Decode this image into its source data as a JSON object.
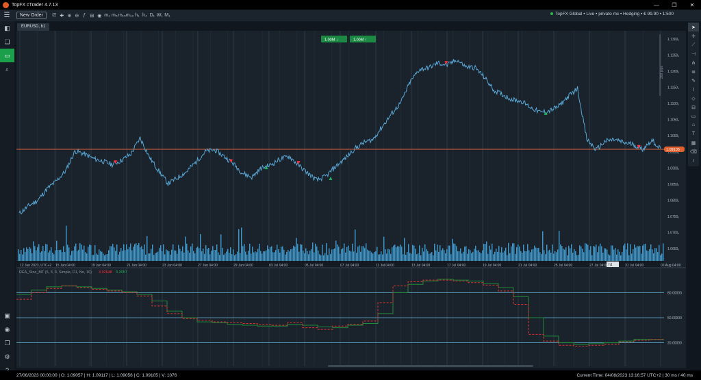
{
  "window": {
    "title": "TopFX cTrader 4.7.13"
  },
  "toolbar": {
    "new_order": "New Order",
    "icons": [
      "chart-type-icon",
      "crosshair-icon",
      "zoom-in-icon",
      "zoom-out-icon",
      "indicators-icon",
      "templates-icon",
      "visibility-icon",
      "tf-m1",
      "tf-m5",
      "tf-m15",
      "tf-m30",
      "tf-h1",
      "tf-h4",
      "tf-d1",
      "tf-w1",
      "tf-mn1"
    ],
    "labels": [
      "⎚",
      "✚",
      "⊕",
      "⊖",
      "ƒ",
      "⊞",
      "◉",
      "m₁",
      "m₅",
      "m₁₅",
      "m₃₀",
      "h₁",
      "h₄",
      "D₁",
      "W₁",
      "M₁"
    ]
  },
  "account": {
    "text": "TopFX Global • Live • privato mc • Hedging • € 99.90 • 1:500"
  },
  "tab": {
    "label": "EURUSD, h1"
  },
  "trade_buttons": {
    "sell": "1,00M ↓",
    "buy": "1,00M ↑"
  },
  "ruler": {
    "label": "200 pips"
  },
  "price_axis": {
    "labels": [
      "1.1300₀",
      "1.1250₀",
      "1.1200₀",
      "1.1150₀",
      "1.1100₀",
      "1.1050₀",
      "1.1000₀",
      "1.0950₀",
      "1.0900₀",
      "1.0850₀",
      "1.0800₀",
      "1.0750₀",
      "1.0700₀",
      "1.0650₀"
    ],
    "current": "1.09105"
  },
  "time_axis": {
    "labels": [
      "12 Jun 2023, UTC+2",
      "15 Jun 04:00",
      "19 Jun 04:00",
      "21 Jun 04:00",
      "23 Jun 04:00",
      "27 Jun 04:00",
      "29 Jun 04:00",
      "03 Jul 04:00",
      "05 Jul 04:00",
      "07 Jul 04:00",
      "11 Jul 04:00",
      "13 Jul 04:00",
      "17 Jul 04:00",
      "19 Jul 04:00",
      "21 Jul 04:00",
      "25 Jul 04:00",
      "27 Jul 04:00",
      "31 Jul 04:00",
      "02 Aug 04:00"
    ],
    "cursor_label": "h1"
  },
  "indicator": {
    "name": "REA_Stoc_MT (5, 3, 3, Simple, D1, No, 10)",
    "val1": "3.92648",
    "val2": "3.2057",
    "levels": [
      "80.00000",
      "50.00000",
      "20.00000"
    ]
  },
  "status": {
    "left": "27/06/2023 00:00:00 | O: 1.09057 | H: 1.09117 | L: 1.09056 | C: 1.09105 | V: 1076",
    "right": "Current Time: 04/08/2023 13:16:57   UTC+2   |  30 ms / 40 ms"
  },
  "colors": {
    "price_line": "#5aa8d6",
    "volume": "#3f95c6",
    "sell": "#ff2e3a",
    "buy": "#21b35a",
    "stoch_main": "#d9342f",
    "stoch_signal": "#1f8a3a",
    "hline": "#d9603a"
  },
  "chart_data": {
    "type": "line",
    "price_series": [
      1.0768,
      1.0792,
      1.081,
      1.0846,
      1.087,
      1.0902,
      1.0964,
      1.0955,
      1.094,
      1.0932,
      1.0922,
      1.0935,
      1.0955,
      1.1005,
      1.0945,
      1.0902,
      1.0862,
      1.088,
      1.09,
      1.093,
      1.0962,
      1.0968,
      1.0948,
      1.0925,
      1.0895,
      1.0882,
      1.091,
      1.092,
      1.0938,
      1.0948,
      1.092,
      1.0895,
      1.0872,
      1.0886,
      1.0915,
      1.094,
      1.097,
      1.099,
      1.1,
      1.104,
      1.108,
      1.1115,
      1.118,
      1.122,
      1.1225,
      1.124,
      1.1233,
      1.125,
      1.1228,
      1.1225,
      1.1195,
      1.1155,
      1.114,
      1.1125,
      1.112,
      1.11,
      1.1085,
      1.109,
      1.1105,
      1.1135,
      1.116,
      1.1,
      1.0968,
      1.0995,
      1.1,
      1.099,
      1.0985,
      1.097,
      1.0998,
      1.0968
    ],
    "ylim": [
      1.062,
      1.133
    ],
    "stoch_main": [
      72,
      80,
      85,
      88,
      86,
      84,
      82,
      80,
      76,
      64,
      55,
      49,
      47,
      45,
      44,
      43,
      42,
      41,
      44,
      38,
      36,
      40,
      42,
      46,
      68,
      88,
      93,
      95,
      95,
      94,
      92,
      89,
      82,
      66,
      30,
      22,
      17,
      16,
      17,
      18,
      21,
      23,
      24
    ],
    "stoch_signal": [
      78,
      83,
      87,
      88,
      87,
      85,
      83,
      81,
      78,
      70,
      58,
      50,
      45,
      44,
      42,
      41,
      40,
      40,
      42,
      41,
      39,
      38,
      41,
      43,
      55,
      80,
      90,
      94,
      96,
      95,
      94,
      91,
      86,
      75,
      50,
      28,
      20,
      18,
      19,
      20,
      22,
      24,
      24
    ],
    "stoch_levels": [
      80,
      50,
      20
    ],
    "sell_markers": [
      0.15,
      0.33,
      0.435,
      0.665,
      0.965
    ],
    "buy_markers": [
      0.385,
      0.485,
      0.82
    ]
  }
}
